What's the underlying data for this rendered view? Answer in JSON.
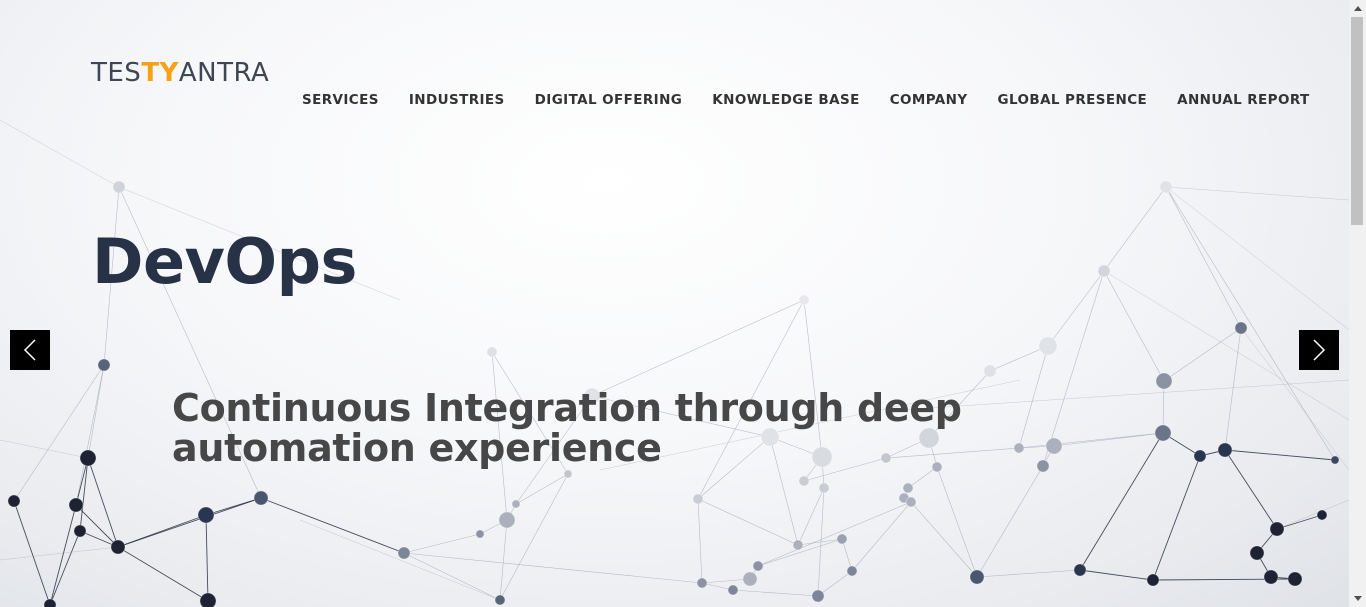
{
  "brand": {
    "logo_parts": [
      {
        "text": "TES",
        "accent": false
      },
      {
        "text": "TY",
        "accent": true
      },
      {
        "text": "ANTRA",
        "accent": false
      }
    ],
    "accent_color": "#f5a11a",
    "text_color": "#3e4554"
  },
  "nav": {
    "items": [
      "SERVICES",
      "INDUSTRIES",
      "DIGITAL OFFERING",
      "KNOWLEDGE BASE",
      "COMPANY",
      "GLOBAL PRESENCE",
      "ANNUAL REPORT"
    ]
  },
  "hero": {
    "title": "DevOps",
    "subtitle": "Continuous Integration through deep automation experience",
    "title_color": "#283247",
    "subtitle_color": "#474747"
  },
  "slider": {
    "prev_icon": "chevron-left-icon",
    "next_icon": "chevron-right-icon"
  },
  "scrollbar": {
    "up_icon": "triangle-up-icon",
    "down_icon": "triangle-down-icon"
  }
}
